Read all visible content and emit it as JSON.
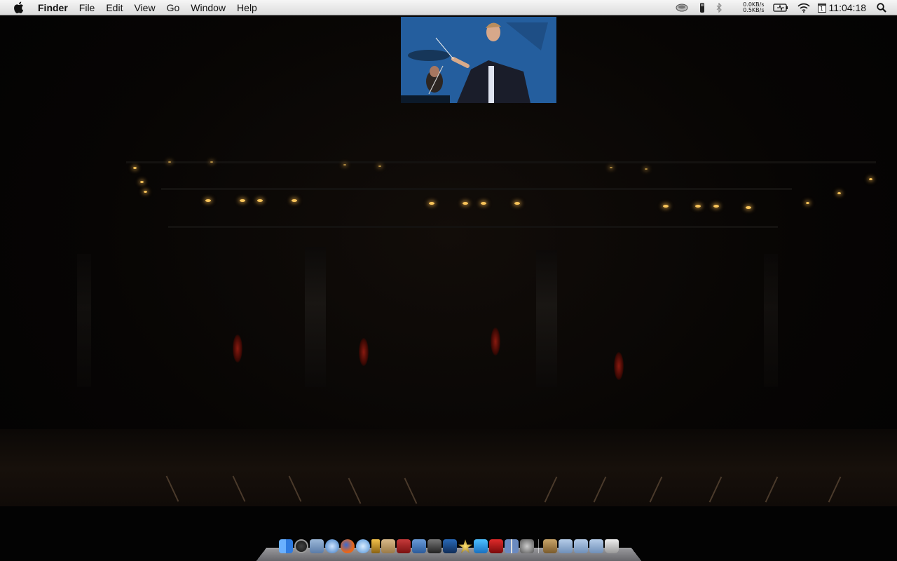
{
  "menubar": {
    "apple_icon": "apple-logo-icon",
    "app_name": "Finder",
    "menus": [
      "File",
      "Edit",
      "View",
      "Go",
      "Window",
      "Help"
    ],
    "network": {
      "down": "0.0KB/s",
      "up": "0.5KB/s"
    },
    "calendar_day": "1",
    "clock": "11:04:18",
    "status_icons": [
      "dropbox-icon",
      "usb-drive-icon",
      "bluetooth-icon",
      "network-meter",
      "battery-icon",
      "wifi-icon",
      "calendar-icon",
      "clock",
      "spotlight-search-icon"
    ]
  },
  "desktop": {
    "wallpaper": "orchestra-concert-photo"
  },
  "dock": {
    "apps": [
      "finder-icon",
      "dashboard-icon",
      "mail-icon",
      "safari-icon",
      "firefox-icon",
      "ichat-icon",
      "itunes-icon",
      "address-book-icon",
      "dictionary-icon",
      "iphoto-icon",
      "imovie-icon",
      "garageband-icon",
      "iweb-icon",
      "text-edit-icon",
      "spaces-icon",
      "preview-icon",
      "system-preferences-icon"
    ],
    "stacks": [
      "applications-stack-icon",
      "documents-folder-icon",
      "downloads-folder-icon",
      "folder-icon",
      "trash-icon"
    ]
  }
}
